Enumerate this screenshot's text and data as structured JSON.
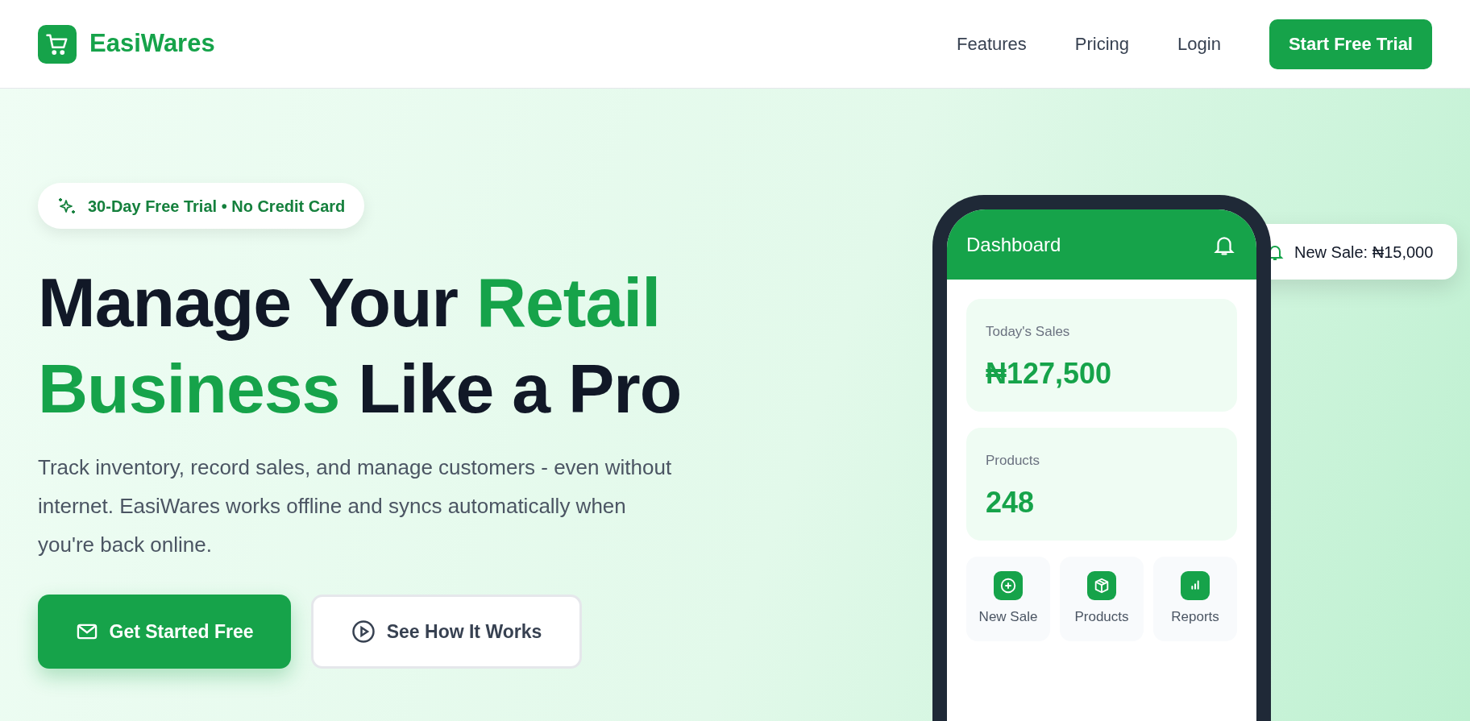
{
  "nav": {
    "brand": "EasiWares",
    "links": [
      "Features",
      "Pricing",
      "Login"
    ],
    "cta": "Start Free Trial"
  },
  "hero": {
    "badge": "30-Day Free Trial • No Credit Card",
    "headline_lines": [
      [
        {
          "text": "Manage Your ",
          "accent": false
        },
        {
          "text": "Retail",
          "accent": true
        }
      ],
      [
        {
          "text": "Business",
          "accent": true
        },
        {
          "text": " Like a Pro",
          "accent": false
        }
      ]
    ],
    "description": "Track inventory, record sales, and manage customers - even without internet. EasiWares works offline and syncs automatically when you're back online.",
    "buttons": [
      {
        "label": "Get Started Free",
        "kind": "primary"
      },
      {
        "label": "See How It Works",
        "kind": "outline"
      }
    ]
  },
  "phone": {
    "title": "Dashboard",
    "stats": [
      {
        "label": "Today's Sales",
        "value": "₦127,500"
      },
      {
        "label": "Products",
        "value": "248"
      }
    ],
    "actions": [
      {
        "label": "New Sale",
        "kind": "plus"
      },
      {
        "label": "Products",
        "kind": "box"
      },
      {
        "label": "Reports",
        "kind": "chart"
      }
    ]
  },
  "notification": {
    "text": "New Sale: ₦15,000"
  }
}
